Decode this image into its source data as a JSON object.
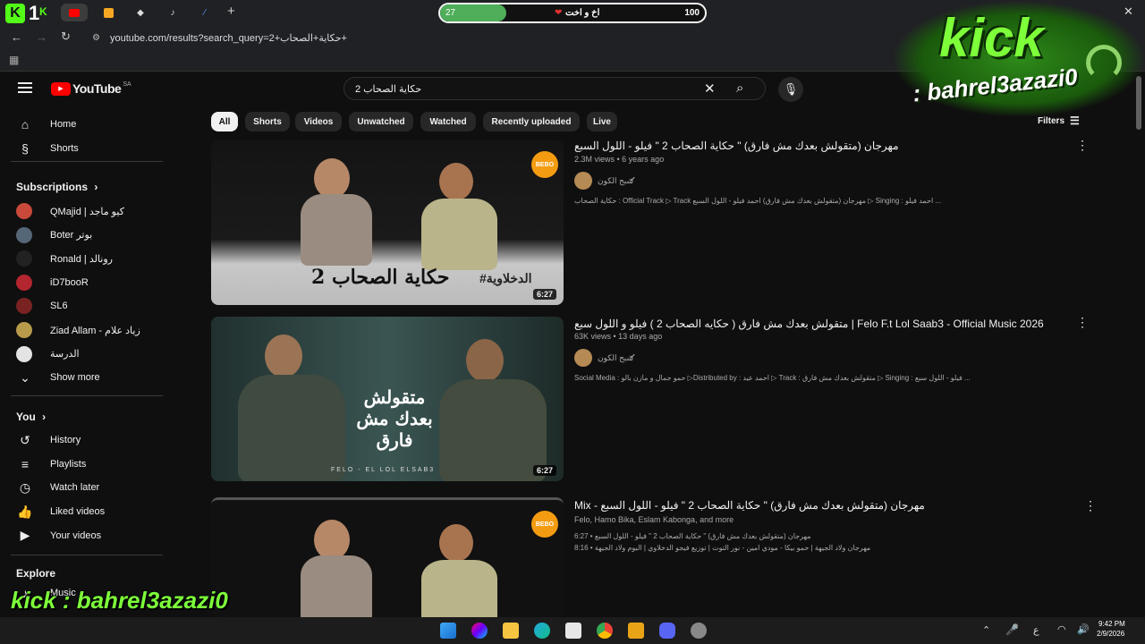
{
  "browser": {
    "url": "youtube.com/results?search_query=2+حكاية+الصحاب+",
    "progress_left": "27",
    "progress_right": "100",
    "progress_label": "اخ و اخت",
    "progress_fraction": 0.25
  },
  "overlay": {
    "top_logo_line1": "kick",
    "top_logo_line2": ": bahrel3azazi0",
    "bottom_text": "kick : bahrel3azazi0",
    "corner_badge": "1"
  },
  "youtube": {
    "logo": "YouTube",
    "region": "SA",
    "search_value": "حكاية الصحاب 2",
    "nav": [
      {
        "label": "Home",
        "icon": "home-icon"
      },
      {
        "label": "Shorts",
        "icon": "shorts-icon"
      }
    ],
    "subscriptions_heading": "Subscriptions",
    "subscriptions": [
      {
        "label": "QMajid | كيو ماجد",
        "color": "#c94a3a"
      },
      {
        "label": "Boter بوتر",
        "color": "#556677"
      },
      {
        "label": "Ronald | رونالد",
        "color": "#222222"
      },
      {
        "label": "iD7booR",
        "color": "#b3262f"
      },
      {
        "label": "SL6",
        "color": "#7a2222"
      },
      {
        "label": "Ziad Allam - زياد علام",
        "color": "#b79a4a"
      },
      {
        "label": "الدرسة",
        "color": "#e3e3e3"
      }
    ],
    "show_more": "Show more",
    "you_heading": "You",
    "you_items": [
      {
        "label": "History",
        "icon": "history-icon"
      },
      {
        "label": "Playlists",
        "icon": "playlists-icon"
      },
      {
        "label": "Watch later",
        "icon": "watch-later-icon"
      },
      {
        "label": "Liked videos",
        "icon": "like-icon"
      },
      {
        "label": "Your videos",
        "icon": "your-videos-icon"
      }
    ],
    "explore_heading": "Explore",
    "explore_items": [
      {
        "label": "Music",
        "icon": "music-icon"
      }
    ],
    "chips": [
      "All",
      "Shorts",
      "Videos",
      "Unwatched",
      "Watched",
      "Recently uploaded",
      "Live"
    ],
    "filters": "Filters",
    "results": [
      {
        "title": "مهرجان (متقولش بعدك مش فارق) \" حكاية الصحاب 2 \" فيلو - اللول السبع",
        "meta": "2.3M views • 6 years ago",
        "channel": "شبح الكون",
        "desc": "حكاية الصحاب : Official Track ▷ Track مهرجان (متقولش بعدك مش فارق) احمد فيلو - اللول السبع ▷ Singing : احمد فيلو ...",
        "duration": "6:27",
        "thumb_text": "حكاية الصحاب 2",
        "thumb_tag": "#الدخلاوية",
        "badge": "BEBO"
      },
      {
        "title": "متقولش بعدك مش فارق ( حكايه الصحاب 2 ) فيلو و اللول سبع | Felo F.t Lol Saab3 - Official Music 2026",
        "meta": "63K views • 13 days ago",
        "channel": "شبح الكون",
        "desc": "Social Media : حمو جمال و مازن بالو ▷Distributed by : احمد عيد ▷ Track : متقولش بعدك مش فارق ▷ Singing : فيلو - اللول سبع ...",
        "duration": "6:27",
        "thumb_text": "متقولش بعدك مش فارق",
        "thumb_tag": "FELO - EL LOL ELSAB3"
      },
      {
        "title": "Mix - مهرجان (متقولش بعدك مش فارق) \" حكاية الصحاب 2 \" فيلو - اللول السبع",
        "meta": "Felo, Hamo Bika, Eslam Kabonga, and more",
        "line1": "مهرجان (متقولش بعدك مش فارق) \" حكاية الصحاب 2 \" فيلو - اللول السبع • 6:27",
        "line2": "مهرجان ولاد الجيهة | حمو بيكا - مودي امين - نور التوت | توزيع فيجو الدخلاوي | البوم ولاد الجيهة • 8:16",
        "badge": "BEBO"
      }
    ]
  },
  "taskbar": {
    "time": "9:42 PM",
    "date": "2/9/2026",
    "lang": "ع"
  }
}
